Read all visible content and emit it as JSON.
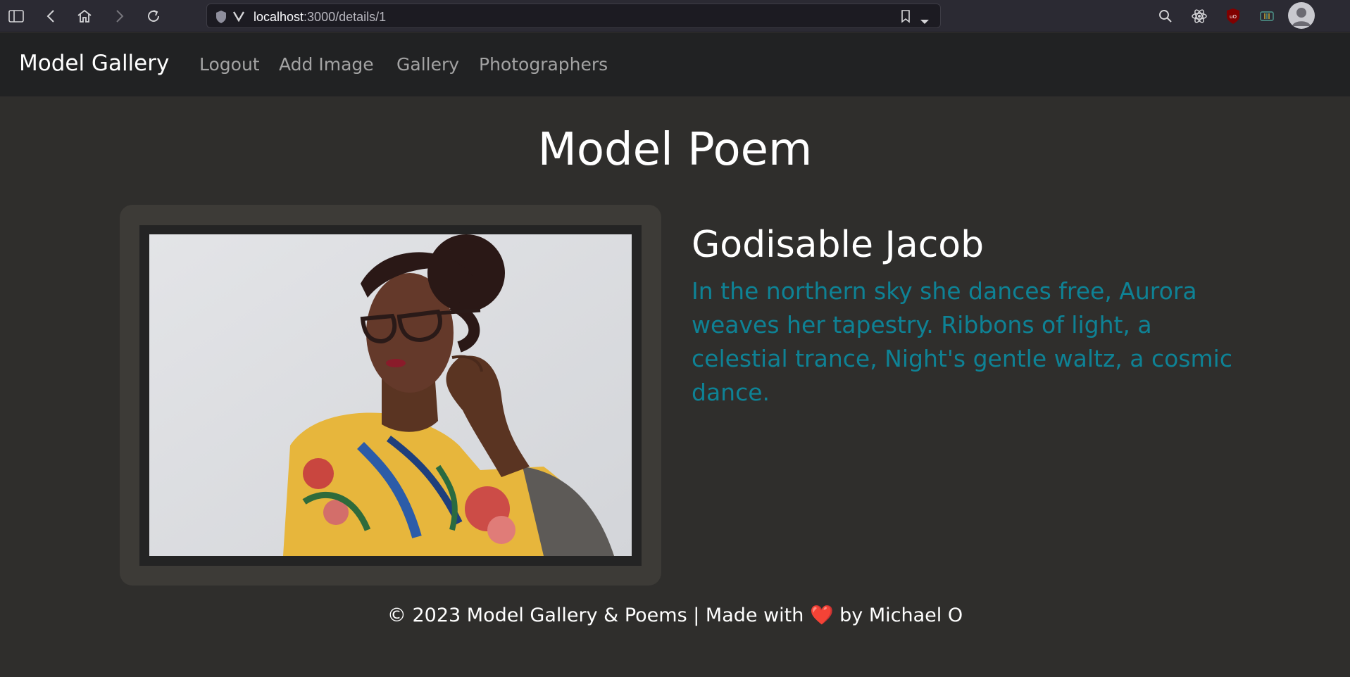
{
  "browser": {
    "url_host": "localhost",
    "url_path": ":3000/details/1",
    "icons": [
      "sidebar-icon",
      "back-icon",
      "home-icon",
      "forward-icon",
      "reload-icon",
      "shield-icon",
      "vivaldi-icon",
      "bookmark-icon",
      "dropdown-icon",
      "search-icon",
      "react-icon",
      "ublock-icon",
      "extension-icon",
      "profile-avatar"
    ]
  },
  "navbar": {
    "brand": "Model Gallery",
    "links": [
      "Logout",
      "Add Image",
      "Gallery",
      "Photographers"
    ]
  },
  "main": {
    "title": "Model Poem",
    "model_name": "Godisable Jacob",
    "poem": "In the northern sky she dances free, Aurora weaves her tapestry. Ribbons of light, a celestial trance, Night's gentle waltz, a cosmic dance."
  },
  "footer": {
    "before_heart": "© 2023 Model Gallery & Poems | Made with ",
    "heart": "❤️",
    "after_heart": " by Michael O"
  },
  "colors": {
    "page_bg": "#2f2e2c",
    "navbar_bg": "#212223",
    "poem_text": "#0e8295",
    "card_bg": "#3d3b37"
  }
}
